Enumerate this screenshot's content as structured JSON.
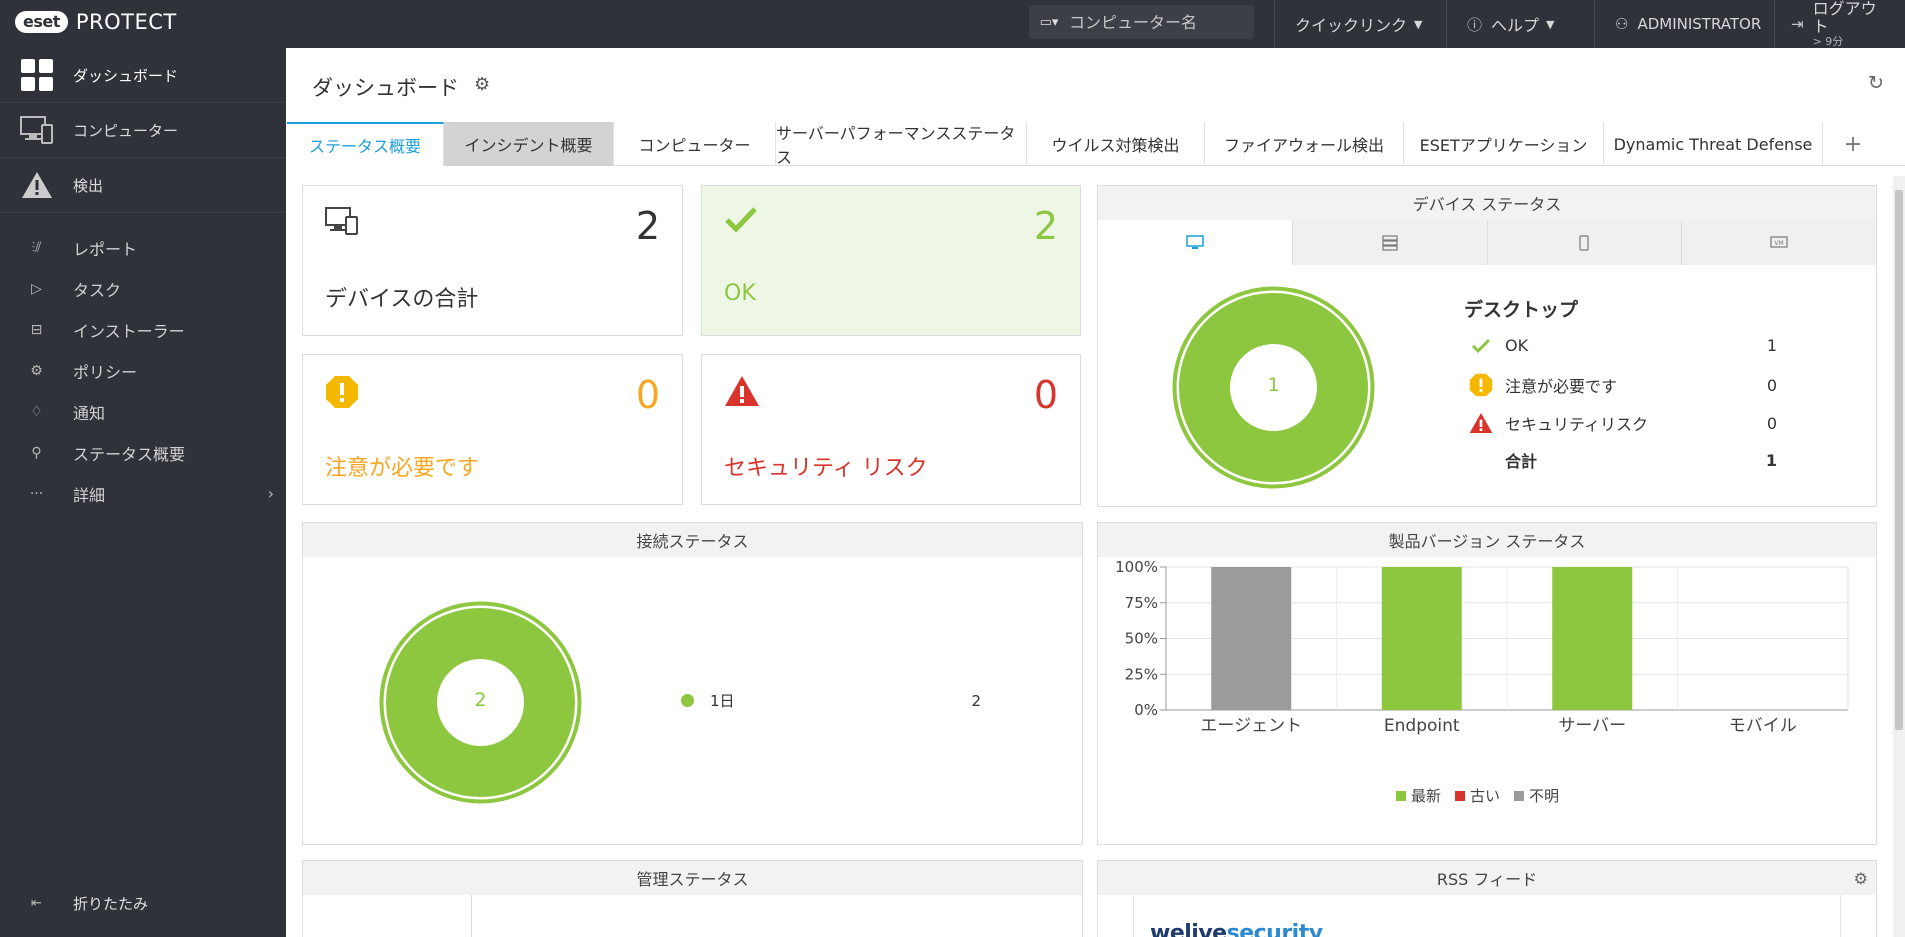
{
  "topbar": {
    "brand_badge": "eset",
    "brand_name": "PROTECT",
    "search_placeholder": "コンピューター名",
    "quick_links": "クイックリンク",
    "help": "ヘルプ",
    "user": "ADMINISTRATOR",
    "logout": "ログアウト",
    "logout_time": "> 9分"
  },
  "sidebar": {
    "main": [
      {
        "label": "ダッシュボード",
        "icon": "dashboard-icon"
      },
      {
        "label": "コンピューター",
        "icon": "computer-icon"
      },
      {
        "label": "検出",
        "icon": "warning-icon"
      }
    ],
    "items": [
      {
        "label": "レポート",
        "icon": "chart-icon"
      },
      {
        "label": "タスク",
        "icon": "task-icon"
      },
      {
        "label": "インストーラー",
        "icon": "installer-icon"
      },
      {
        "label": "ポリシー",
        "icon": "gear-icon"
      },
      {
        "label": "通知",
        "icon": "bell-icon"
      },
      {
        "label": "ステータス概要",
        "icon": "status-icon"
      },
      {
        "label": "詳細",
        "icon": "more-icon"
      }
    ],
    "more_glyph": "···",
    "collapse": "折りたたみ"
  },
  "header": {
    "title": "ダッシュボード"
  },
  "tabs": [
    "ステータス概要",
    "インシデント概要",
    "コンピューター",
    "サーバーパフォーマンスステータス",
    "ウイルス対策検出",
    "ファイアウォール検出",
    "ESETアプリケーション",
    "Dynamic Threat Defense",
    "+"
  ],
  "cards": {
    "total": {
      "value": "2",
      "label": "デバイスの合計"
    },
    "ok": {
      "value": "2",
      "label": "OK"
    },
    "attention": {
      "value": "0",
      "label": "注意が必要です"
    },
    "risk": {
      "value": "0",
      "label": "セキュリティ リスク"
    }
  },
  "device_status": {
    "title": "デバイス ステータス",
    "donut_center": "1",
    "ok_fraction": 1,
    "category": "デスクトップ",
    "rows": [
      {
        "label": "OK",
        "value": "1"
      },
      {
        "label": "注意が必要です",
        "value": "0"
      },
      {
        "label": "セキュリティリスク",
        "value": "0"
      },
      {
        "label": "合計",
        "value": "1"
      }
    ]
  },
  "connection_status": {
    "title": "接続ステータス",
    "donut_center": "2",
    "legend_label": "1日",
    "legend_value": "2"
  },
  "product_version": {
    "title": "製品バージョン ステータス"
  },
  "management_status": {
    "title": "管理ステータス"
  },
  "rss": {
    "title": "RSS フィード",
    "logo_a": "welive",
    "logo_b": "security"
  },
  "colors": {
    "ok": "#8dc63f",
    "attention": "#f5a623",
    "risk": "#d9342b",
    "unknown": "#9b9b9b",
    "accent": "#1a9fd9"
  },
  "chart_data": {
    "type": "bar",
    "categories": [
      "エージェント",
      "Endpoint",
      "サーバー",
      "モバイル"
    ],
    "series": [
      {
        "name": "最新",
        "color": "#8dc63f",
        "values": [
          0,
          100,
          100,
          0
        ]
      },
      {
        "name": "古い",
        "color": "#d9342b",
        "values": [
          0,
          0,
          0,
          0
        ]
      },
      {
        "name": "不明",
        "color": "#9b9b9b",
        "values": [
          100,
          0,
          0,
          0
        ]
      }
    ],
    "yticks": [
      "0%",
      "25%",
      "50%",
      "75%",
      "100%"
    ],
    "ylim": [
      0,
      100
    ],
    "stacked": true,
    "grid": true,
    "legend_position": "bottom"
  }
}
